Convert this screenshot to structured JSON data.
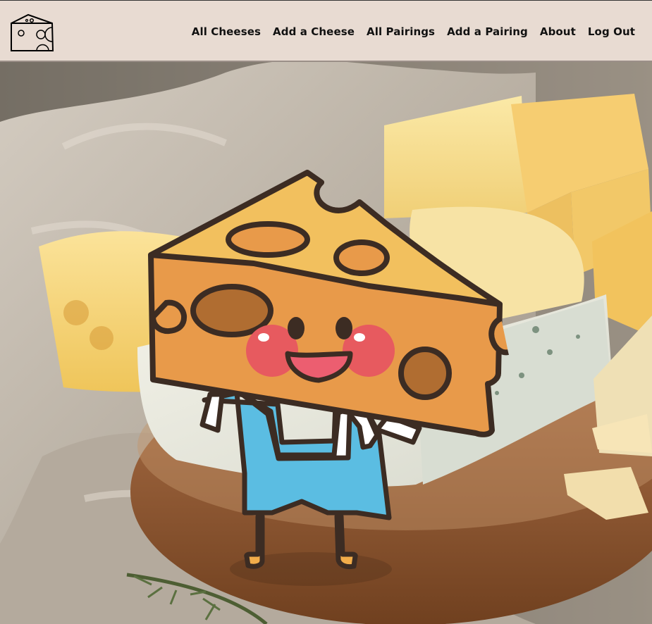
{
  "nav": {
    "items": [
      {
        "label": "All Cheeses"
      },
      {
        "label": "Add a Cheese"
      },
      {
        "label": "All Pairings"
      },
      {
        "label": "Add a Pairing"
      },
      {
        "label": "About"
      },
      {
        "label": "Log Out"
      }
    ]
  },
  "colors": {
    "header_bg": "#e8dbd2",
    "mascot_cheese": "#e89a4a",
    "mascot_cheese_top": "#f2c05e",
    "mascot_holes": "#b06d31",
    "mascot_overalls": "#5bbde2",
    "outline": "#3c2c23"
  },
  "icons": {
    "logo": "cheese-logo-icon",
    "hero": "cheese-mascot"
  }
}
